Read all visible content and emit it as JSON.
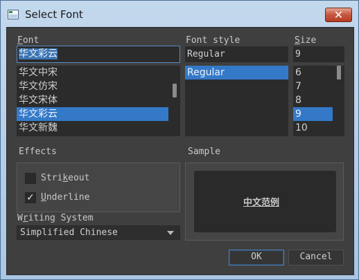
{
  "window": {
    "title": "Select Font",
    "close_label": "✕"
  },
  "font": {
    "label": "Font",
    "value": "华文彩云",
    "items": [
      "华文中宋",
      "华文仿宋",
      "华文宋体",
      "华文彩云",
      "华文新魏"
    ],
    "selected": "华文彩云"
  },
  "font_style": {
    "label": "Font style",
    "value": "Regular",
    "items": [
      "Regular"
    ],
    "selected": "Regular"
  },
  "size": {
    "label": "Size",
    "value": "9",
    "items": [
      "6",
      "7",
      "8",
      "9",
      "10"
    ],
    "selected": "9"
  },
  "effects": {
    "label": "Effects",
    "strikeout_label": "Strikeout",
    "strikeout_checked": false,
    "underline_label": "Underline",
    "underline_checked": true,
    "check_mark": "✓"
  },
  "writing_system": {
    "label": "Writing System",
    "value": "Simplified Chinese"
  },
  "sample": {
    "label": "Sample",
    "text": "中文范例"
  },
  "buttons": {
    "ok": "OK",
    "cancel": "Cancel"
  }
}
